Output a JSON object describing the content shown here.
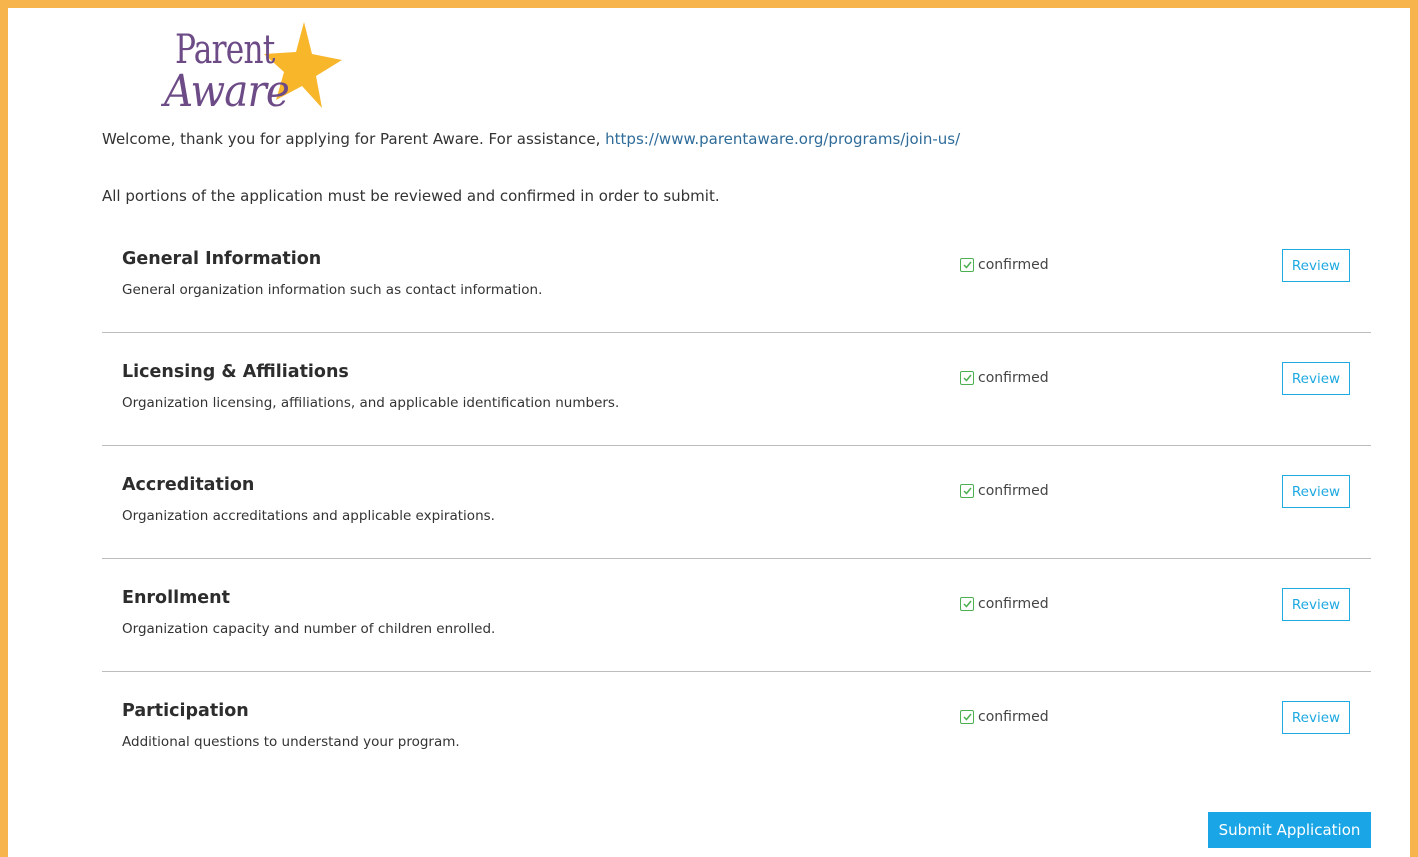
{
  "logo": {
    "line1": "Parent",
    "line2": "Aware"
  },
  "intro": {
    "text": "Welcome, thank you for applying for Parent Aware. For assistance, ",
    "link": "https://www.parentaware.org/programs/join-us/"
  },
  "notice": "All portions of the application must be reviewed and confirmed in order to submit.",
  "sections": [
    {
      "title": "General Information",
      "description": "General organization information such as contact information.",
      "status": "confirmed",
      "button": "Review"
    },
    {
      "title": "Licensing & Affiliations",
      "description": "Organization licensing, affiliations, and applicable identification numbers.",
      "status": "confirmed",
      "button": "Review"
    },
    {
      "title": "Accreditation",
      "description": "Organization accreditations and applicable expirations.",
      "status": "confirmed",
      "button": "Review"
    },
    {
      "title": "Enrollment",
      "description": "Organization capacity and number of children enrolled.",
      "status": "confirmed",
      "button": "Review"
    },
    {
      "title": "Participation",
      "description": "Additional questions to understand your program.",
      "status": "confirmed",
      "button": "Review"
    }
  ],
  "submit_label": "Submit Application",
  "colors": {
    "frame": "#f7b34c",
    "brand_purple": "#6d4b86",
    "star": "#f8b62b",
    "accent": "#1aa6e6",
    "confirmed": "#4caf50"
  }
}
